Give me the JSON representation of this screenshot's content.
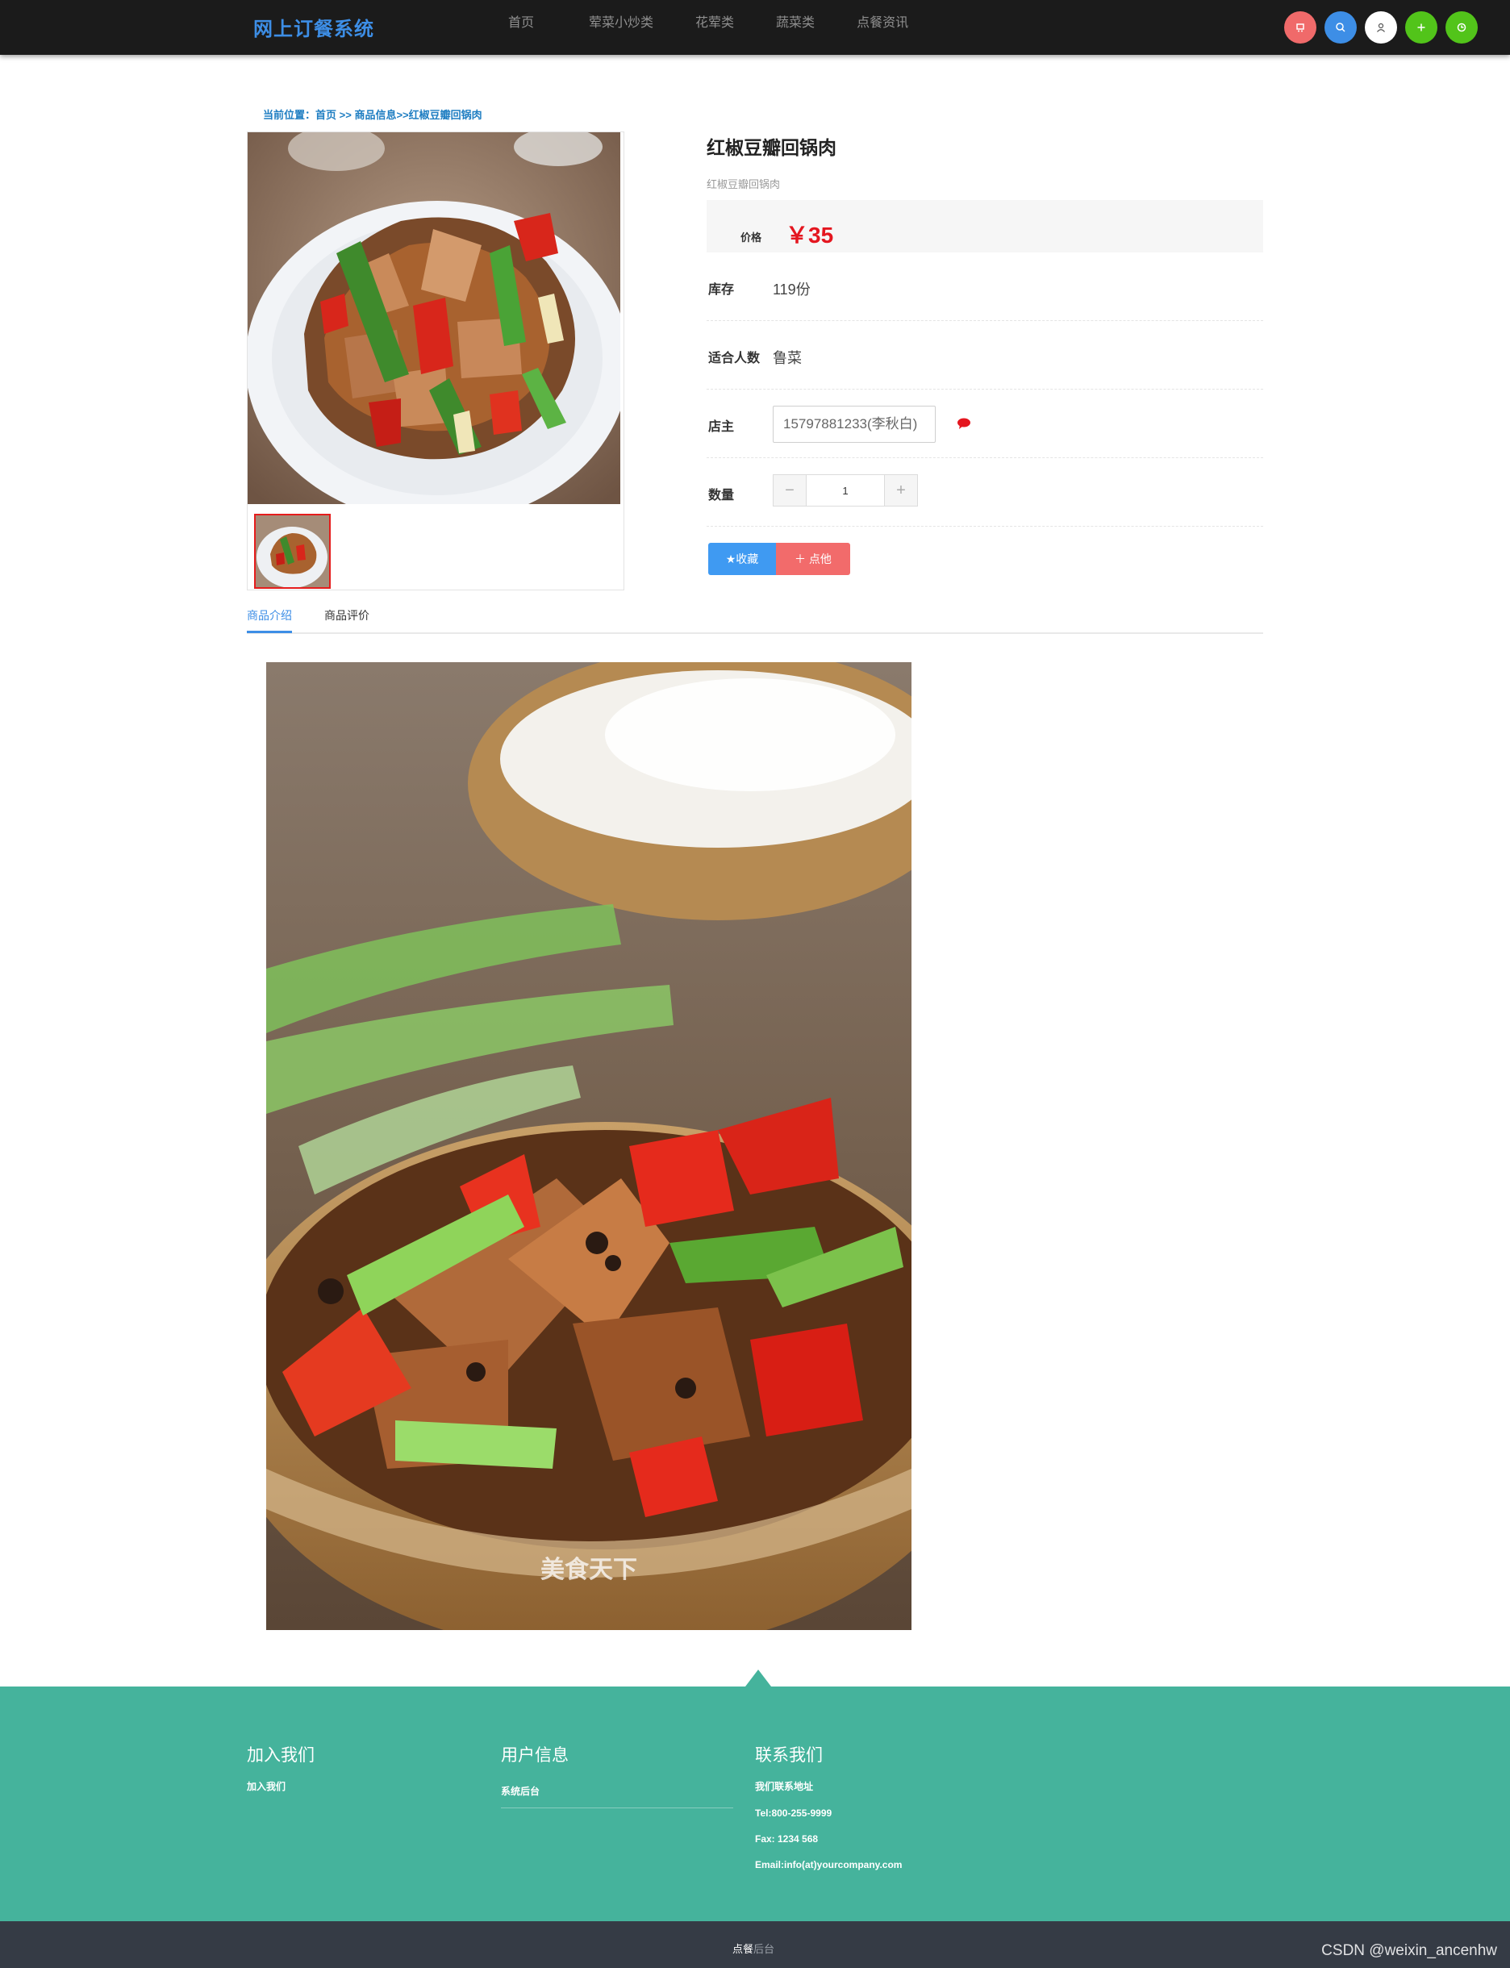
{
  "nav": {
    "brand": "网上订餐系统",
    "items": [
      "首页",
      "荤菜小炒类",
      "花荤类",
      "蔬菜类",
      "点餐资讯"
    ],
    "icons": [
      {
        "name": "cart-icon",
        "color": "#f06a6a"
      },
      {
        "name": "search-icon",
        "color": "#3d8ee6"
      },
      {
        "name": "user-icon",
        "color": "#ffffff"
      },
      {
        "name": "add-icon",
        "color": "#52c41a"
      },
      {
        "name": "clock-icon",
        "color": "#52c41a"
      }
    ]
  },
  "breadcrumb": {
    "label": "当前位置：",
    "home": "首页",
    "sep1": " >> ",
    "section": "商品信息",
    "sep2": ">>",
    "current": "红椒豆瓣回锅肉"
  },
  "product": {
    "title": "红椒豆瓣回锅肉",
    "subtitle": "红椒豆瓣回锅肉",
    "price_label": "价格",
    "price": "￥35",
    "stock_label": "库存",
    "stock": "119份",
    "serves_label": "适合人数",
    "serves": "鲁菜",
    "owner_label": "店主",
    "owner": "15797881233(李秋白)",
    "qty_label": "数量",
    "qty_minus": "−",
    "qty_value": "1",
    "qty_plus": "+",
    "fav_button": "★收藏",
    "order_button": "＋ 点他"
  },
  "tabs": [
    "商品介绍",
    "商品评价"
  ],
  "detail_watermark": "美食天下",
  "footer": {
    "col1_title": "加入我们",
    "col1_items": [
      "加入我们"
    ],
    "col2_title": "用户信息",
    "col2_items": [
      "系统后台"
    ],
    "col3_title": "联系我们",
    "col3_items": [
      "我们联系地址",
      "Tel:800-255-9999",
      "Fax: 1234 568",
      "Email:info(at)yourcompany.com"
    ]
  },
  "bottom": {
    "prefix": "点餐",
    "suffix": "后台"
  },
  "watermark": "CSDN @weixin_ancenhw",
  "colors": {
    "accent": "#3d8ee6",
    "price": "#e4161f",
    "footer": "#45b39c",
    "bottom_bar": "#353b45"
  }
}
